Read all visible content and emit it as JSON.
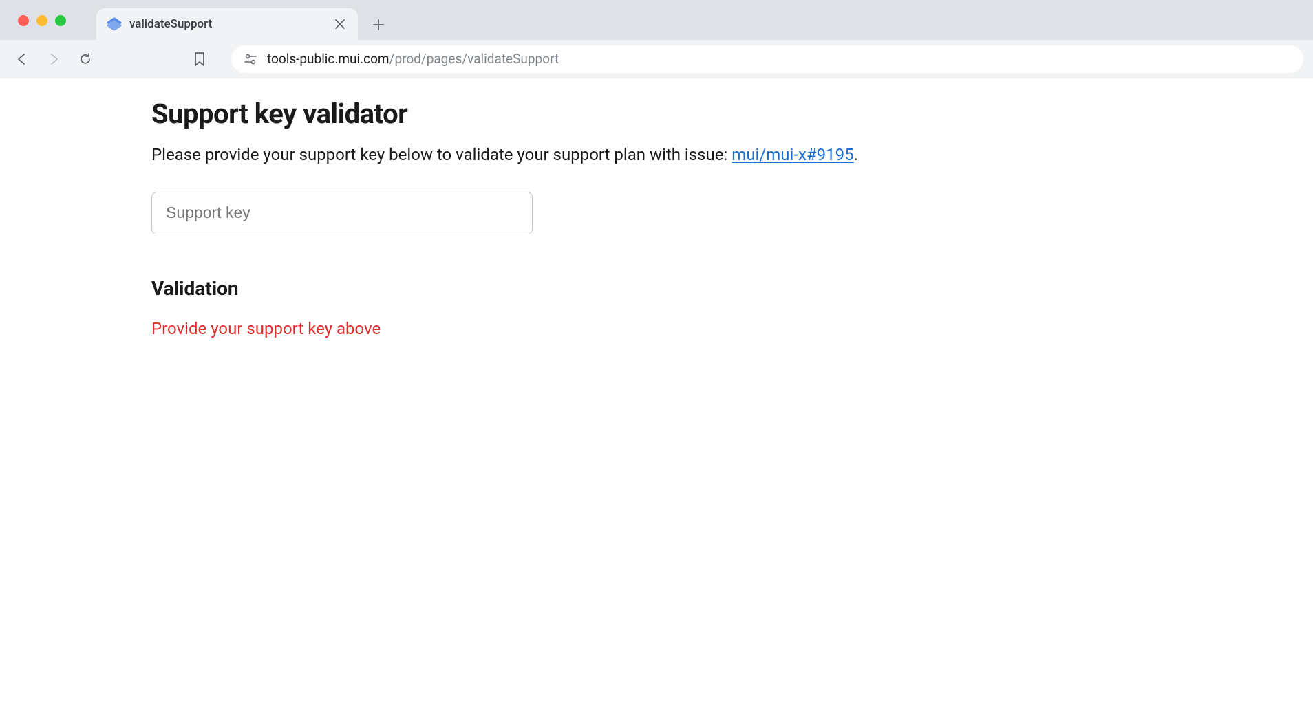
{
  "browser": {
    "tab_title": "validateSupport",
    "url_domain": "tools-public.mui.com",
    "url_path": "/prod/pages/validateSupport"
  },
  "page": {
    "title": "Support key validator",
    "description_prefix": "Please provide your support key below to validate your support plan with issue: ",
    "issue_link_text": "mui/mui-x#9195",
    "description_suffix": ".",
    "input_placeholder": "Support key",
    "validation_heading": "Validation",
    "validation_message": "Provide your support key above"
  }
}
